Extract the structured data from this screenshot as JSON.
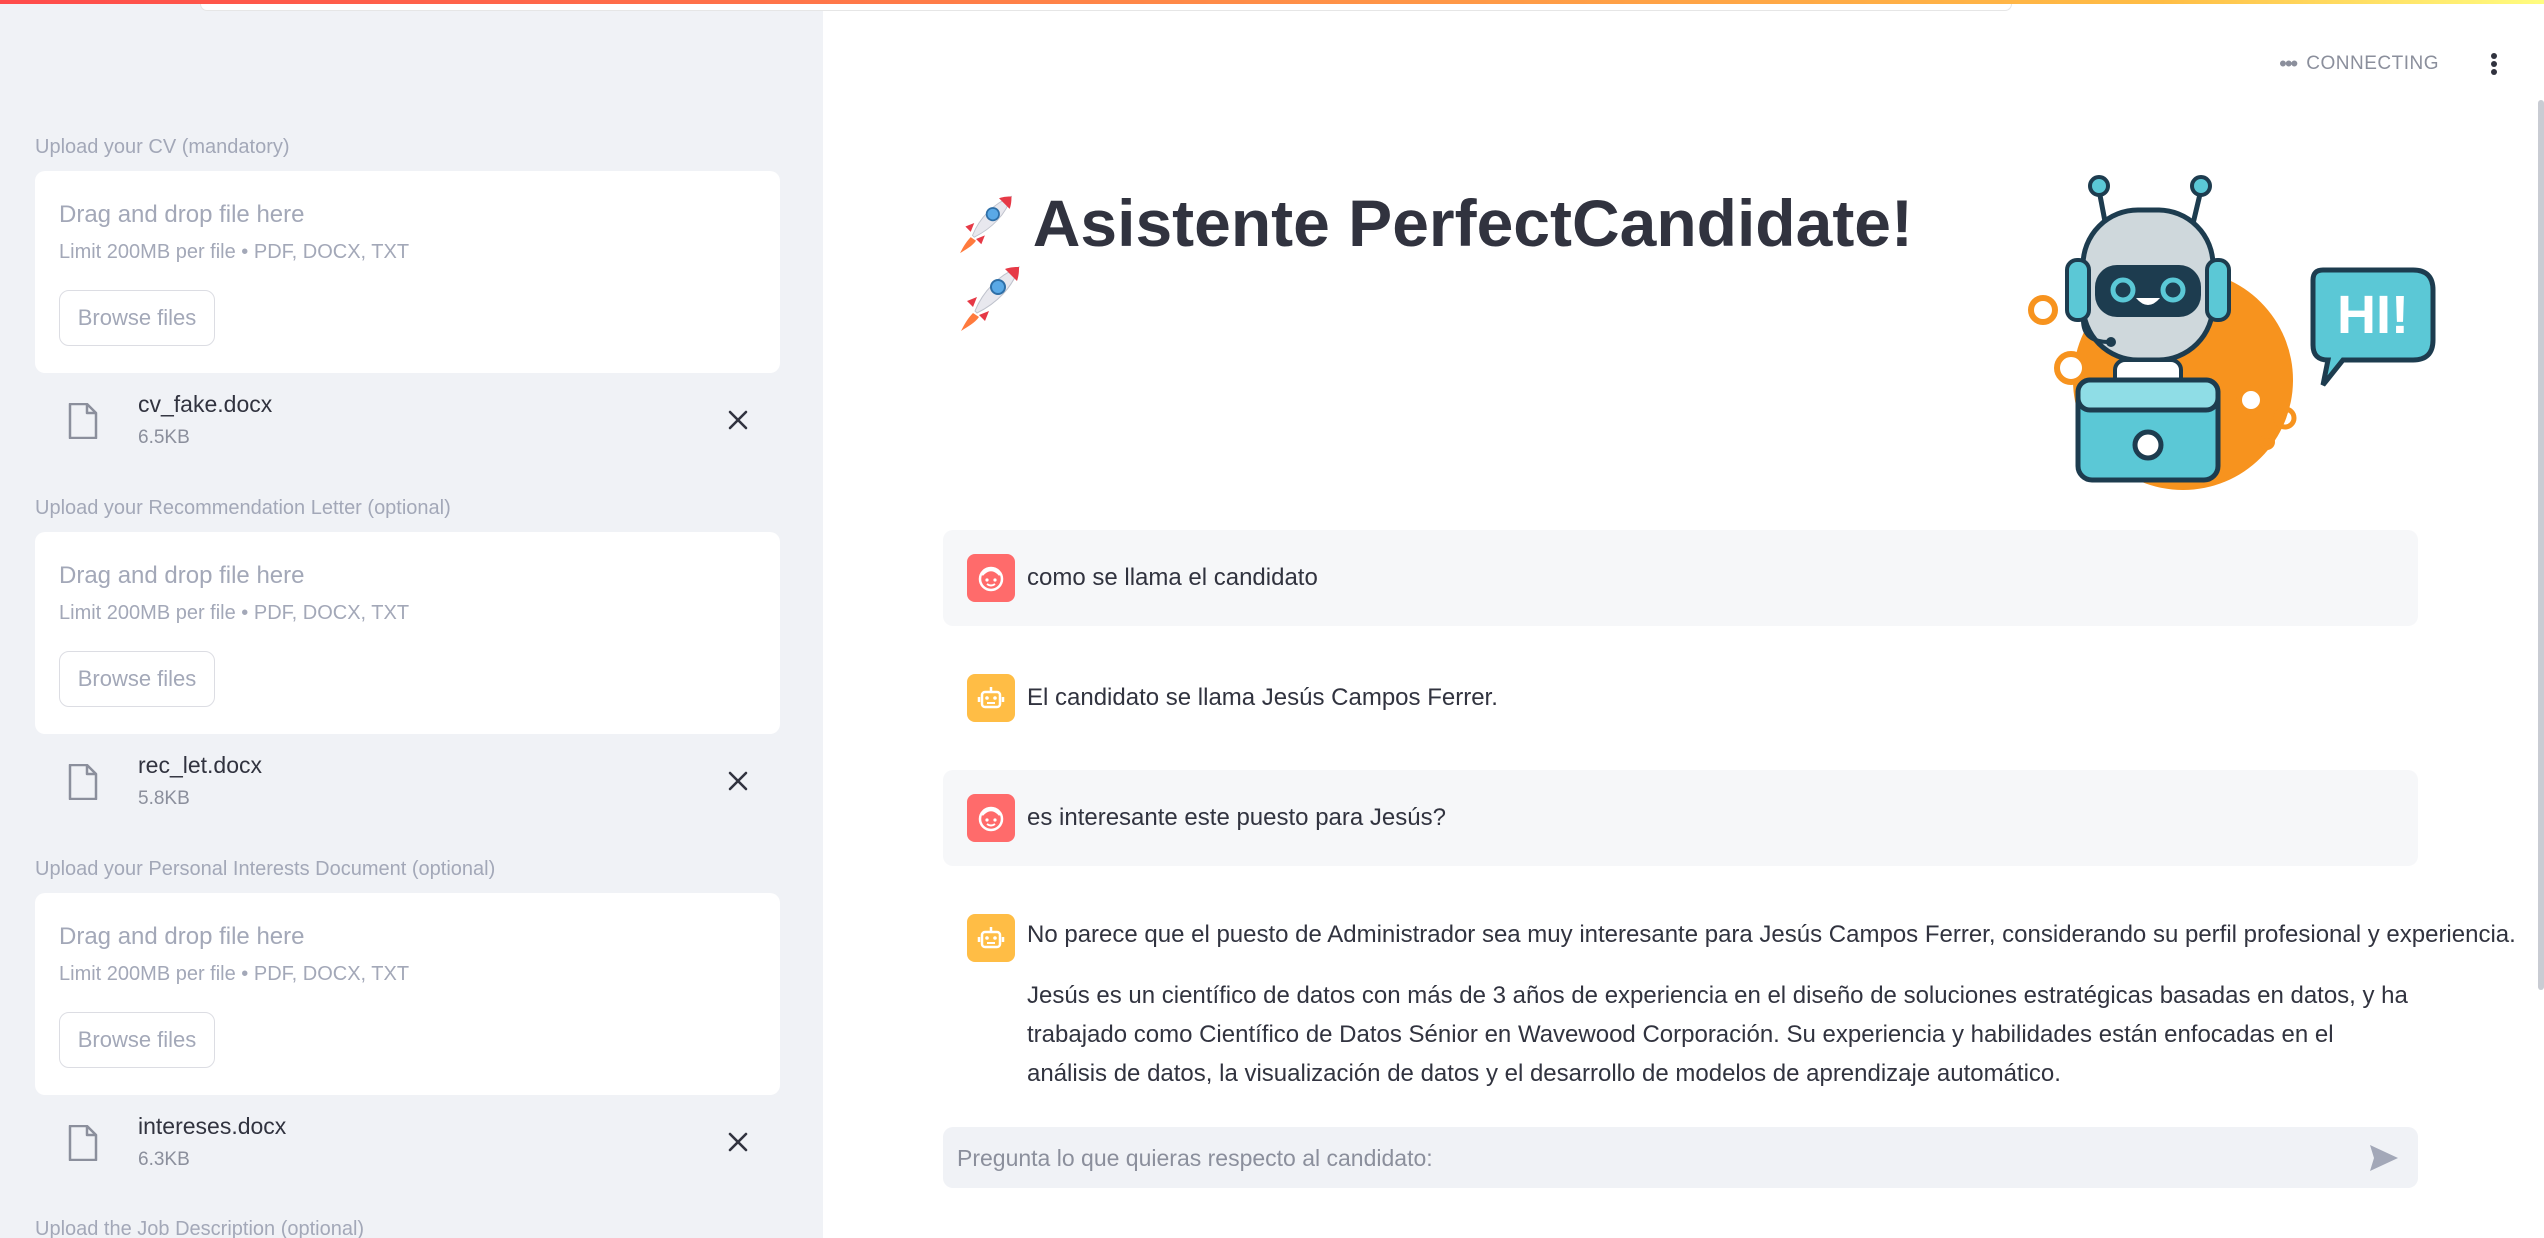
{
  "sidebar": {
    "uploaders": [
      {
        "label": "Upload your CV (mandatory)",
        "drop_title": "Drag and drop file here",
        "limit": "Limit 200MB per file • PDF, DOCX, TXT",
        "browse_label": "Browse files",
        "file": {
          "name": "cv_fake.docx",
          "size": "6.5KB"
        }
      },
      {
        "label": "Upload your Recommendation Letter (optional)",
        "drop_title": "Drag and drop file here",
        "limit": "Limit 200MB per file • PDF, DOCX, TXT",
        "browse_label": "Browse files",
        "file": {
          "name": "rec_let.docx",
          "size": "5.8KB"
        }
      },
      {
        "label": "Upload your Personal Interests Document (optional)",
        "drop_title": "Drag and drop file here",
        "limit": "Limit 200MB per file • PDF, DOCX, TXT",
        "browse_label": "Browse files",
        "file": {
          "name": "intereses.docx",
          "size": "6.3KB"
        }
      },
      {
        "label": "Upload the Job Description (optional)"
      }
    ]
  },
  "header": {
    "status": "CONNECTING",
    "menu_icon": "kebab-menu-icon"
  },
  "main": {
    "title": "Asistente PerfectCandidate!",
    "title_emoji": "rocket-icon",
    "hero_image": "robot-hi-illustration",
    "hero_text": "HI!",
    "messages": [
      {
        "role": "user",
        "text": "como se llama el candidato"
      },
      {
        "role": "assistant",
        "text": "El candidato se llama Jesús Campos Ferrer."
      },
      {
        "role": "user",
        "text": "es interesante este puesto para Jesús?"
      },
      {
        "role": "assistant",
        "paragraphs": [
          "No parece que el puesto de Administrador sea muy interesante para Jesús Campos Ferrer, considerando su perfil profesional y experiencia.",
          "Jesús es un científico de datos con más de 3 años de experiencia en el diseño de soluciones estratégicas basadas en datos, y ha trabajado como Científico de Datos Sénior en Wavewood Corporación. Su experiencia y habilidades están enfocadas en el análisis de datos, la visualización de datos y el desarrollo de modelos de aprendizaje automático."
        ]
      }
    ],
    "chat_input": {
      "placeholder": "Pregunta lo que quieras respecto al candidato:",
      "value": ""
    }
  },
  "colors": {
    "user_avatar": "#ff6b6b",
    "bot_avatar": "#ffbd45",
    "sidebar_bg": "#f0f2f6",
    "accent": "#ff4b4b"
  }
}
